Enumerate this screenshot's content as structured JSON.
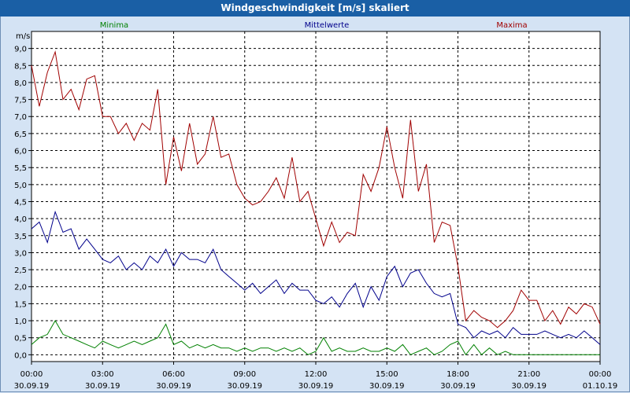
{
  "window": {
    "title": "Windgeschwindigkeit [m/s] skaliert"
  },
  "chart_data": {
    "type": "line",
    "title": "Windgeschwindigkeit [m/s] skaliert",
    "ylabel": "m/s",
    "ylim": [
      -0.2,
      9.5
    ],
    "xlim": [
      0,
      24
    ],
    "y_ticks": [
      "9,0",
      "8,5",
      "8,0",
      "7,5",
      "7,0",
      "6,5",
      "6,0",
      "5,5",
      "5,0",
      "4,5",
      "4,0",
      "3,5",
      "3,0",
      "2,5",
      "2,0",
      "1,5",
      "1,0",
      "0,5",
      "0,0"
    ],
    "y_tick_values": [
      9,
      8.5,
      8,
      7.5,
      7,
      6.5,
      6,
      5.5,
      5,
      4.5,
      4,
      3.5,
      3,
      2.5,
      2,
      1.5,
      1,
      0.5,
      0
    ],
    "x_ticks": [
      {
        "time": "00:00",
        "date": "30.09.19"
      },
      {
        "time": "03:00",
        "date": "30.09.19"
      },
      {
        "time": "06:00",
        "date": "30.09.19"
      },
      {
        "time": "09:00",
        "date": "30.09.19"
      },
      {
        "time": "12:00",
        "date": "30.09.19"
      },
      {
        "time": "15:00",
        "date": "30.09.19"
      },
      {
        "time": "18:00",
        "date": "30.09.19"
      },
      {
        "time": "21:00",
        "date": "30.09.19"
      },
      {
        "time": "00:00",
        "date": "01.10.19"
      }
    ],
    "x_tick_hours": [
      0,
      3,
      6,
      9,
      12,
      15,
      18,
      21,
      24
    ],
    "grid": true,
    "legend_position": "top",
    "series": [
      {
        "name": "Minima",
        "color": "#008000",
        "x": [
          0,
          0.33,
          0.67,
          1,
          1.33,
          1.67,
          2,
          2.33,
          2.67,
          3,
          3.33,
          3.67,
          4,
          4.33,
          4.67,
          5,
          5.33,
          5.67,
          6,
          6.33,
          6.67,
          7,
          7.33,
          7.67,
          8,
          8.33,
          8.67,
          9,
          9.33,
          9.67,
          10,
          10.33,
          10.67,
          11,
          11.33,
          11.67,
          12,
          12.33,
          12.67,
          13,
          13.33,
          13.67,
          14,
          14.33,
          14.67,
          15,
          15.33,
          15.67,
          16,
          16.33,
          16.67,
          17,
          17.33,
          17.67,
          18,
          18.33,
          18.67,
          19,
          19.33,
          19.67,
          20,
          20.33,
          20.67,
          21,
          21.33,
          21.67,
          22,
          22.33,
          22.67,
          23,
          23.33,
          23.67,
          24
        ],
        "values": [
          0.3,
          0.5,
          0.6,
          1.0,
          0.6,
          0.5,
          0.4,
          0.3,
          0.2,
          0.4,
          0.3,
          0.2,
          0.3,
          0.4,
          0.3,
          0.4,
          0.5,
          0.9,
          0.3,
          0.4,
          0.2,
          0.3,
          0.2,
          0.3,
          0.2,
          0.2,
          0.1,
          0.2,
          0.1,
          0.2,
          0.2,
          0.1,
          0.2,
          0.1,
          0.2,
          0.0,
          0.1,
          0.5,
          0.1,
          0.2,
          0.1,
          0.1,
          0.2,
          0.1,
          0.1,
          0.2,
          0.1,
          0.3,
          0.0,
          0.1,
          0.2,
          0.0,
          0.1,
          0.3,
          0.4,
          0.0,
          0.3,
          0.0,
          0.2,
          0.0,
          0.1,
          0.0,
          0.0,
          0.0,
          0.0,
          0.0,
          0.0,
          0.0,
          0.0,
          0.0,
          0.0,
          0.0,
          0.0
        ]
      },
      {
        "name": "Mittelwerte",
        "color": "#00008b",
        "x": [
          0,
          0.33,
          0.67,
          1,
          1.33,
          1.67,
          2,
          2.33,
          2.67,
          3,
          3.33,
          3.67,
          4,
          4.33,
          4.67,
          5,
          5.33,
          5.67,
          6,
          6.33,
          6.67,
          7,
          7.33,
          7.67,
          8,
          8.33,
          8.67,
          9,
          9.33,
          9.67,
          10,
          10.33,
          10.67,
          11,
          11.33,
          11.67,
          12,
          12.33,
          12.67,
          13,
          13.33,
          13.67,
          14,
          14.33,
          14.67,
          15,
          15.33,
          15.67,
          16,
          16.33,
          16.67,
          17,
          17.33,
          17.67,
          18,
          18.33,
          18.67,
          19,
          19.33,
          19.67,
          20,
          20.33,
          20.67,
          21,
          21.33,
          21.67,
          22,
          22.33,
          22.67,
          23,
          23.33,
          23.67,
          24
        ],
        "values": [
          3.7,
          3.9,
          3.3,
          4.2,
          3.6,
          3.7,
          3.1,
          3.4,
          3.1,
          2.8,
          2.7,
          2.9,
          2.5,
          2.7,
          2.5,
          2.9,
          2.7,
          3.1,
          2.6,
          3.0,
          2.8,
          2.8,
          2.7,
          3.1,
          2.5,
          2.3,
          2.1,
          1.9,
          2.1,
          1.8,
          2.0,
          2.2,
          1.8,
          2.1,
          1.9,
          1.9,
          1.6,
          1.5,
          1.7,
          1.4,
          1.8,
          2.1,
          1.4,
          2.0,
          1.6,
          2.3,
          2.6,
          2.0,
          2.4,
          2.5,
          2.1,
          1.8,
          1.7,
          1.8,
          0.9,
          0.8,
          0.5,
          0.7,
          0.6,
          0.7,
          0.5,
          0.8,
          0.6,
          0.6,
          0.6,
          0.7,
          0.6,
          0.5,
          0.6,
          0.5,
          0.7,
          0.5,
          0.3
        ]
      },
      {
        "name": "Maxima",
        "color": "#a00000",
        "x": [
          0,
          0.33,
          0.67,
          1,
          1.33,
          1.67,
          2,
          2.33,
          2.67,
          3,
          3.33,
          3.67,
          4,
          4.33,
          4.67,
          5,
          5.33,
          5.67,
          6,
          6.33,
          6.67,
          7,
          7.33,
          7.67,
          8,
          8.33,
          8.67,
          9,
          9.33,
          9.67,
          10,
          10.33,
          10.67,
          11,
          11.33,
          11.67,
          12,
          12.33,
          12.67,
          13,
          13.33,
          13.67,
          14,
          14.33,
          14.67,
          15,
          15.33,
          15.67,
          16,
          16.33,
          16.67,
          17,
          17.33,
          17.67,
          18,
          18.33,
          18.67,
          19,
          19.33,
          19.67,
          20,
          20.33,
          20.67,
          21,
          21.33,
          21.67,
          22,
          22.33,
          22.67,
          23,
          23.33,
          23.67,
          24
        ],
        "values": [
          8.5,
          7.3,
          8.3,
          8.9,
          7.5,
          7.8,
          7.2,
          8.1,
          8.2,
          7.0,
          7.0,
          6.5,
          6.8,
          6.3,
          6.8,
          6.6,
          7.8,
          5.0,
          6.4,
          5.4,
          6.8,
          5.6,
          5.9,
          7.0,
          5.8,
          5.9,
          5.0,
          4.6,
          4.4,
          4.5,
          4.8,
          5.2,
          4.6,
          5.8,
          4.5,
          4.8,
          4.0,
          3.2,
          3.9,
          3.3,
          3.6,
          3.5,
          5.3,
          4.8,
          5.5,
          6.7,
          5.5,
          4.6,
          6.9,
          4.8,
          5.6,
          3.3,
          3.9,
          3.8,
          2.6,
          1.0,
          1.3,
          1.1,
          1.0,
          0.8,
          1.0,
          1.3,
          1.9,
          1.6,
          1.6,
          1.0,
          1.3,
          0.9,
          1.4,
          1.2,
          1.5,
          1.4,
          0.9
        ]
      }
    ]
  }
}
